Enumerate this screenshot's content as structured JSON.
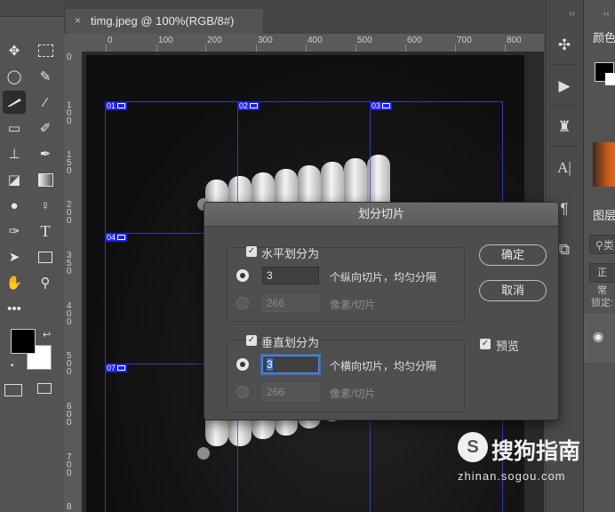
{
  "document_tab": {
    "close": "×",
    "title": "timg.jpeg @ 100%(RGB/8#)"
  },
  "rulers": {
    "h_labels": [
      "0",
      "100",
      "200",
      "300",
      "400",
      "500",
      "600",
      "700",
      "800",
      "900"
    ],
    "v_labels": [
      "0",
      "1 0 0",
      "1 5 0",
      "2 0 0",
      "3 5 0",
      "4 0 0",
      "5 0 0",
      "6 0 0",
      "7 0 0",
      "8"
    ]
  },
  "slices": [
    "01",
    "02",
    "03",
    "04",
    "07"
  ],
  "right_panels": {
    "collapse": "‹‹",
    "color_tab": "颜色",
    "layers_tab": "图层",
    "search_placeholder": "类",
    "blend_mode": "正常",
    "lock_label": "锁定:"
  },
  "dialog": {
    "title": "划分切片",
    "horizontal": {
      "checkbox_label": "水平划分为",
      "checked": true,
      "count_value": "3",
      "count_suffix": "个纵向切片，均匀分隔",
      "pixels_value": "266",
      "pixels_suffix": "像素/切片"
    },
    "vertical": {
      "checkbox_label": "垂直划分为",
      "checked": true,
      "count_value": "3",
      "count_suffix": "个横向切片，均匀分隔",
      "pixels_value": "266",
      "pixels_suffix": "像素/切片"
    },
    "ok_label": "确定",
    "cancel_label": "取消",
    "preview_label": "预览",
    "preview_checked": true
  },
  "watermark": {
    "logo": "S",
    "text": "搜狗指南",
    "url": "zhinan.sogou.com"
  },
  "icons": {
    "toolbar": [
      "move-icon",
      "marquee-icon",
      "lasso-icon",
      "quick-select-icon",
      "slice-icon",
      "eyedropper-icon",
      "healing-icon",
      "brush-icon",
      "stamp-icon",
      "history-brush-icon",
      "eraser-icon",
      "gradient-icon",
      "blur-icon",
      "dodge-icon",
      "pen-icon",
      "type-icon",
      "path-select-icon",
      "rectangle-icon",
      "hand-icon",
      "zoom-icon",
      "more-icon"
    ],
    "right": [
      "puzzle-icon",
      "play-icon",
      "cube-icon",
      "character-icon",
      "paragraph-icon",
      "shapes-icon"
    ]
  },
  "colors": {
    "foreground": "#000000",
    "background": "#ffffff",
    "accent": "#3b6fd6",
    "slice_label": "#1e22e8"
  }
}
